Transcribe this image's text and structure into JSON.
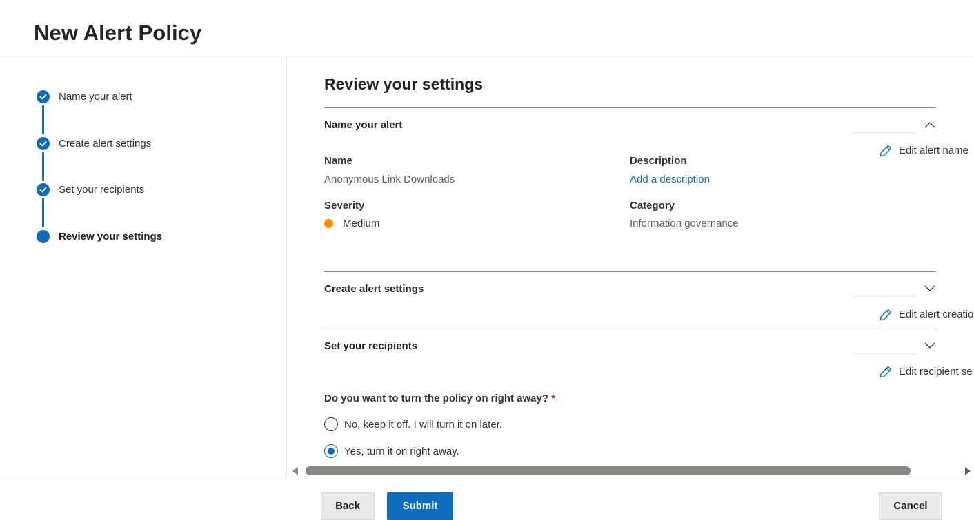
{
  "header": {
    "title": "New Alert Policy"
  },
  "wizard": {
    "steps": [
      {
        "label": "Name your alert",
        "status": "complete"
      },
      {
        "label": "Create alert settings",
        "status": "complete"
      },
      {
        "label": "Set your recipients",
        "status": "complete"
      },
      {
        "label": "Review your settings",
        "status": "current"
      }
    ]
  },
  "main": {
    "title": "Review your settings",
    "sections": {
      "name_alert": {
        "title": "Name your alert",
        "expanded": true,
        "edit_label": "Edit alert name",
        "name_label": "Name",
        "name_value": "Anonymous Link Downloads",
        "description_label": "Description",
        "description_link": "Add a description",
        "severity_label": "Severity",
        "severity_value": "Medium",
        "severity_color": "#ff8c00",
        "category_label": "Category",
        "category_value": "Information governance"
      },
      "create_settings": {
        "title": "Create alert settings",
        "expanded": false,
        "edit_label": "Edit alert creatio"
      },
      "recipients": {
        "title": "Set your recipients",
        "expanded": false,
        "edit_label": "Edit recipient se"
      }
    },
    "policy_question": {
      "text": "Do you want to turn the policy on right away?",
      "required_mark": "*",
      "options": [
        {
          "label": "No, keep it off. I will turn it on later.",
          "selected": false
        },
        {
          "label": "Yes, turn it on right away.",
          "selected": true
        }
      ]
    }
  },
  "footer": {
    "back_label": "Back",
    "submit_label": "Submit",
    "cancel_label": "Cancel"
  },
  "colors": {
    "accent": "#0f6cbd",
    "severity_medium": "#ff8c00",
    "required": "#a4262c"
  }
}
